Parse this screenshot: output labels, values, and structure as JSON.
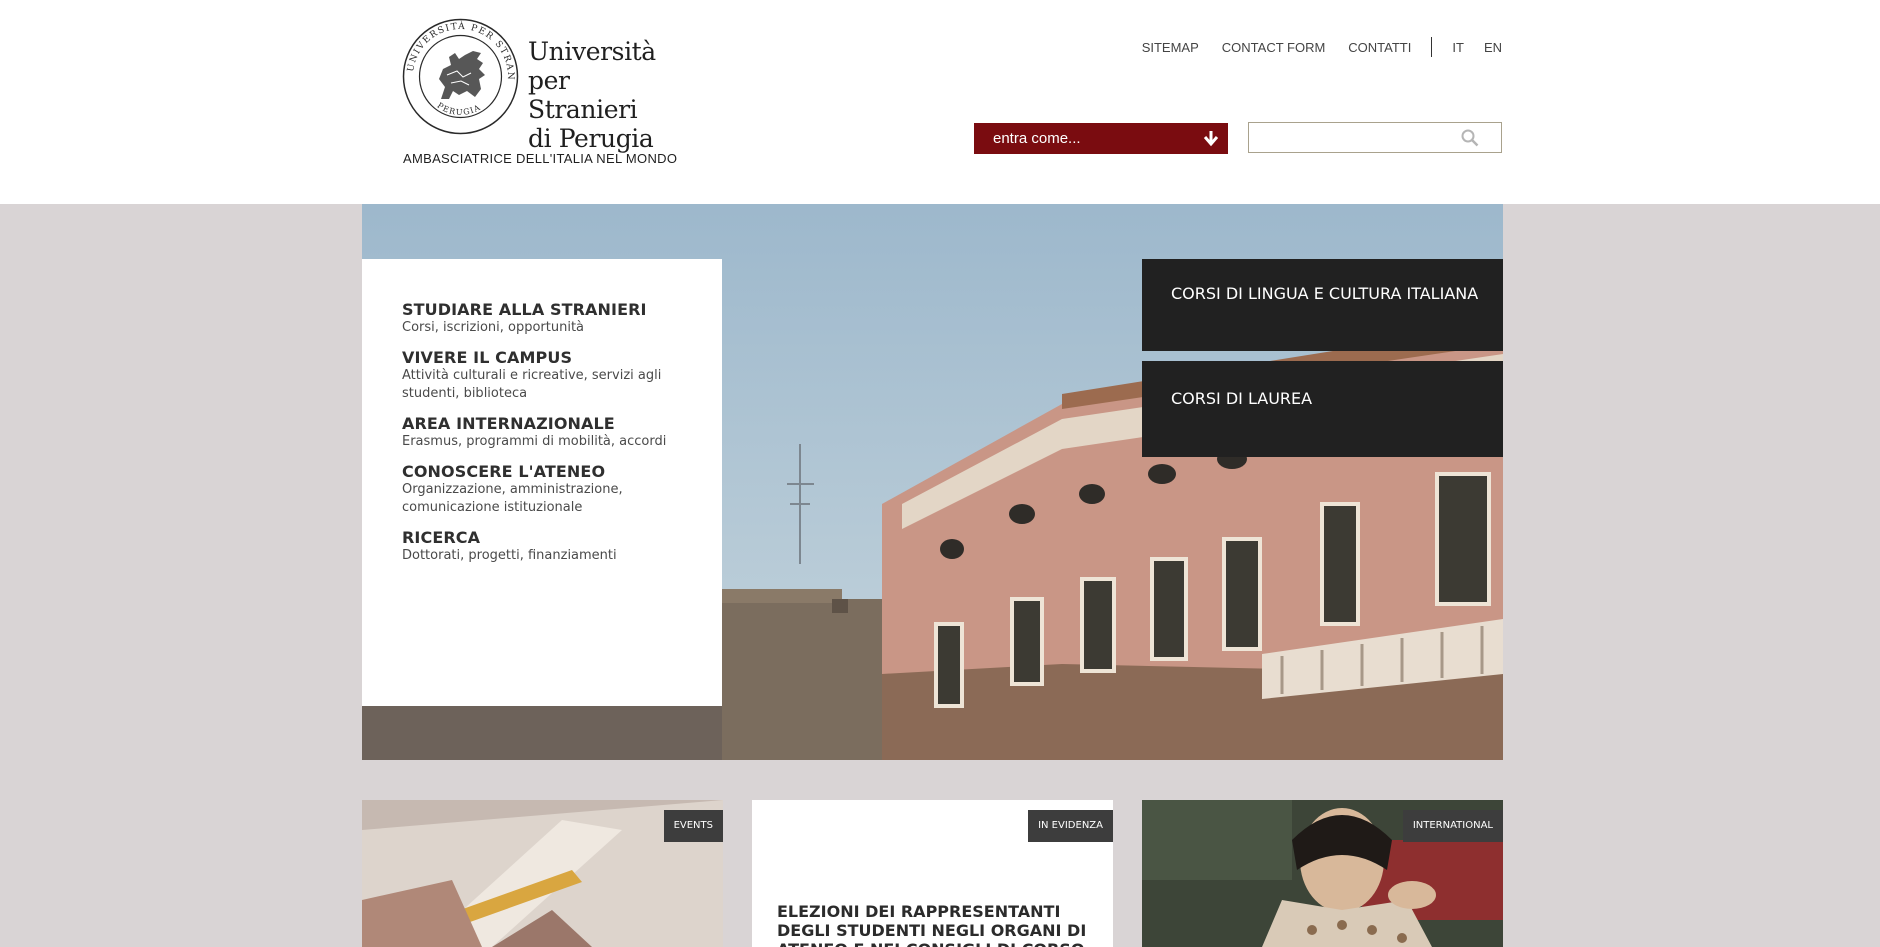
{
  "header": {
    "logo": {
      "seal_text": "UNIVERSITÀ PER STRANIERI PERUGIA",
      "name_lines": [
        "Università",
        "per Stranieri",
        "di Perugia"
      ],
      "tagline": "AMBASCIATRICE DELL'ITALIA NEL MONDO"
    },
    "topnav": {
      "links": [
        "SITEMAP",
        "CONTACT FORM",
        "CONTATTI"
      ],
      "languages": [
        "IT",
        "EN"
      ]
    },
    "enter_select": {
      "label": "entra come...",
      "icon": "arrow-down-icon"
    },
    "search": {
      "placeholder": "",
      "icon": "search-icon"
    }
  },
  "hero": {
    "menu": [
      {
        "title": "STUDIARE ALLA STRANIERI",
        "desc": "Corsi, iscrizioni, opportunità"
      },
      {
        "title": "VIVERE IL CAMPUS",
        "desc": "Attività culturali e ricreative, servizi agli studenti, biblioteca"
      },
      {
        "title": "AREA INTERNAZIONALE",
        "desc": "Erasmus, programmi di mobilità, accordi"
      },
      {
        "title": "CONOSCERE L'ATENEO",
        "desc": "Organizzazione, amministrazione, comunicazione istituzionale"
      },
      {
        "title": "RICERCA",
        "desc": "Dottorati, progetti, finanziamenti"
      }
    ],
    "courses": [
      "CORSI DI LINGUA E CULTURA ITALIANA",
      "CORSI DI LAUREA"
    ]
  },
  "cards": {
    "events": {
      "tag": "EVENTS"
    },
    "evidenza": {
      "tag": "IN EVIDENZA",
      "headline": "ELEZIONI DEI RAPPRESENTANTI DEGLI STUDENTI NEGLI ORGANI DI ATENEO E NEI CONSIGLI DI CORSO COMIP E"
    },
    "international": {
      "tag": "INTERNATIONAL"
    }
  },
  "colors": {
    "brand_red": "#7a0c10",
    "page_background": "#d9d4d5",
    "dark_box": "#212121",
    "tag_background": "#3d3d3d"
  }
}
